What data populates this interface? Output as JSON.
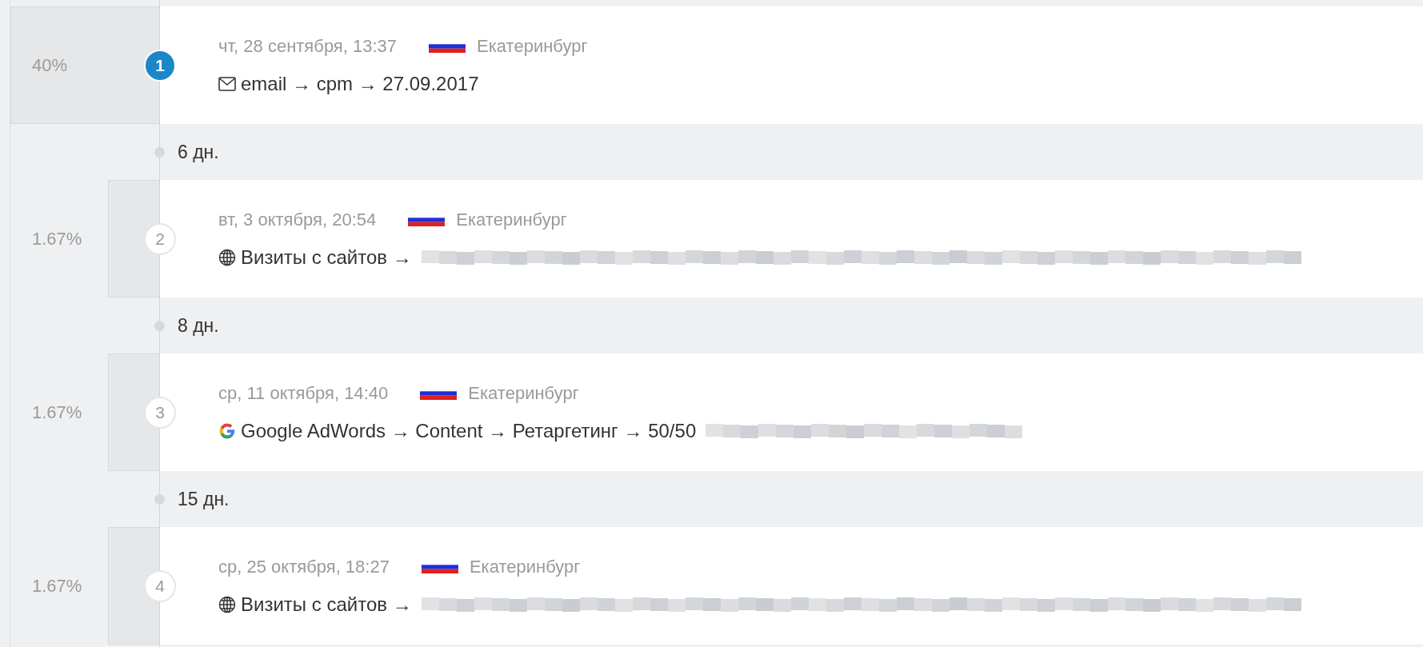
{
  "events": [
    {
      "share": "40%",
      "number": "1",
      "selected": true,
      "date": "чт, 28 сентября, 13:37",
      "city": "Екатеринбург",
      "kind": "email",
      "path": "email → cpm → 27.09.2017",
      "gap_after": "6 дн."
    },
    {
      "share": "1.67%",
      "number": "2",
      "selected": false,
      "date": "вт, 3 октября, 20:54",
      "city": "Екатеринбург",
      "kind": "web",
      "path": "Визиты с сайтов →",
      "redacted": {
        "kind": "long"
      },
      "gap_after": "8 дн."
    },
    {
      "share": "1.67%",
      "number": "3",
      "selected": false,
      "date": "ср, 11 октября, 14:40",
      "city": "Екатеринбург",
      "kind": "google",
      "path": "Google AdWords → Content → Ретаргетинг → 50/50",
      "redacted": {
        "kind": "short"
      },
      "gap_after": "15 дн."
    },
    {
      "share": "1.67%",
      "number": "4",
      "selected": false,
      "date": "ср, 25 октября, 18:27",
      "city": "Екатеринбург",
      "kind": "web",
      "path": "Визиты с сайтов →",
      "redacted": {
        "kind": "long"
      }
    }
  ]
}
